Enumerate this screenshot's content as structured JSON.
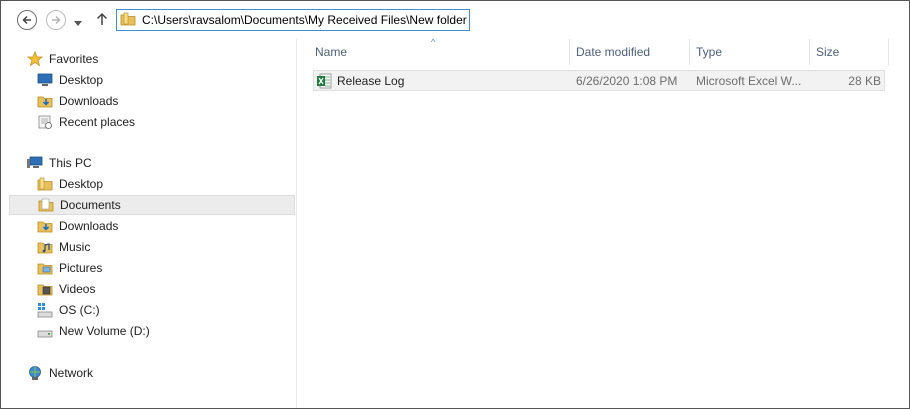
{
  "address": {
    "path": "C:\\Users\\ravsalom\\Documents\\My Received Files\\New folder"
  },
  "colors": {
    "accent": "#3c8fd1",
    "header_text": "#4c607a",
    "selected_bg": "#ececec"
  },
  "nav": {
    "favorites": {
      "label": "Favorites",
      "items": [
        {
          "label": "Desktop",
          "icon": "desktop-icon"
        },
        {
          "label": "Downloads",
          "icon": "downloads-folder-icon"
        },
        {
          "label": "Recent places",
          "icon": "recent-places-icon"
        }
      ]
    },
    "this_pc": {
      "label": "This PC",
      "items": [
        {
          "label": "Desktop",
          "icon": "folder-icon"
        },
        {
          "label": "Documents",
          "icon": "documents-icon",
          "selected": true
        },
        {
          "label": "Downloads",
          "icon": "downloads-folder-icon"
        },
        {
          "label": "Music",
          "icon": "music-folder-icon"
        },
        {
          "label": "Pictures",
          "icon": "pictures-folder-icon"
        },
        {
          "label": "Videos",
          "icon": "videos-folder-icon"
        },
        {
          "label": "OS (C:)",
          "icon": "drive-c-icon"
        },
        {
          "label": "New Volume (D:)",
          "icon": "drive-d-icon"
        }
      ]
    },
    "network": {
      "label": "Network",
      "icon": "network-icon"
    }
  },
  "columns": {
    "name": "Name",
    "date": "Date modified",
    "type": "Type",
    "size": "Size",
    "sort_indicator": "^"
  },
  "files": [
    {
      "name": "Release Log",
      "date": "6/26/2020 1:08 PM",
      "type": "Microsoft Excel W...",
      "size": "28 KB",
      "icon": "excel-file-icon"
    }
  ]
}
